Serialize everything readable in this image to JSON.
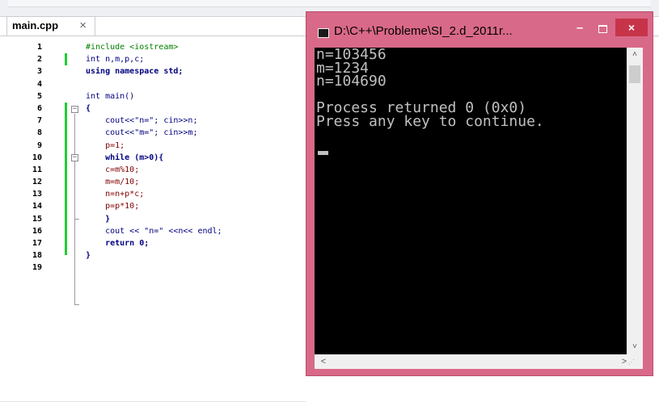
{
  "editor": {
    "tab_label": "main.cpp",
    "tab_close": "×",
    "line_numbers": [
      "1",
      "2",
      "3",
      "4",
      "5",
      "6",
      "7",
      "8",
      "9",
      "10",
      "11",
      "12",
      "13",
      "14",
      "15",
      "16",
      "17",
      "18",
      "19"
    ],
    "code_lines": [
      "#include <iostream>",
      "int n,m,p,c;",
      "using namespace std;",
      "",
      "int main()",
      "{",
      "    cout<<\"n=\"; cin>>n;",
      "    cout<<\"m=\"; cin>>m;",
      "    p=1;",
      "    while (m>0){",
      "    c=m%10;",
      "    m=m/10;",
      "    n=n+p*c;",
      "    p=p*10;",
      "    }",
      "    cout << \"n=\" <<n<< endl;",
      "    return 0;",
      "}",
      ""
    ],
    "change_bar_color": "#22cc33"
  },
  "console": {
    "title": "D:\\C++\\Probleme\\SI_2.d_2011r...",
    "minimize_symbol": "–",
    "close_symbol": "×",
    "output_lines": [
      "n=103456",
      "m=1234",
      "n=104690",
      "",
      "Process returned 0 (0x0)",
      "Press any key to continue."
    ],
    "frame_color": "#d96988",
    "scroll_up": "˄",
    "scroll_down": "˅",
    "scroll_left": "<",
    "scroll_right": ">"
  }
}
